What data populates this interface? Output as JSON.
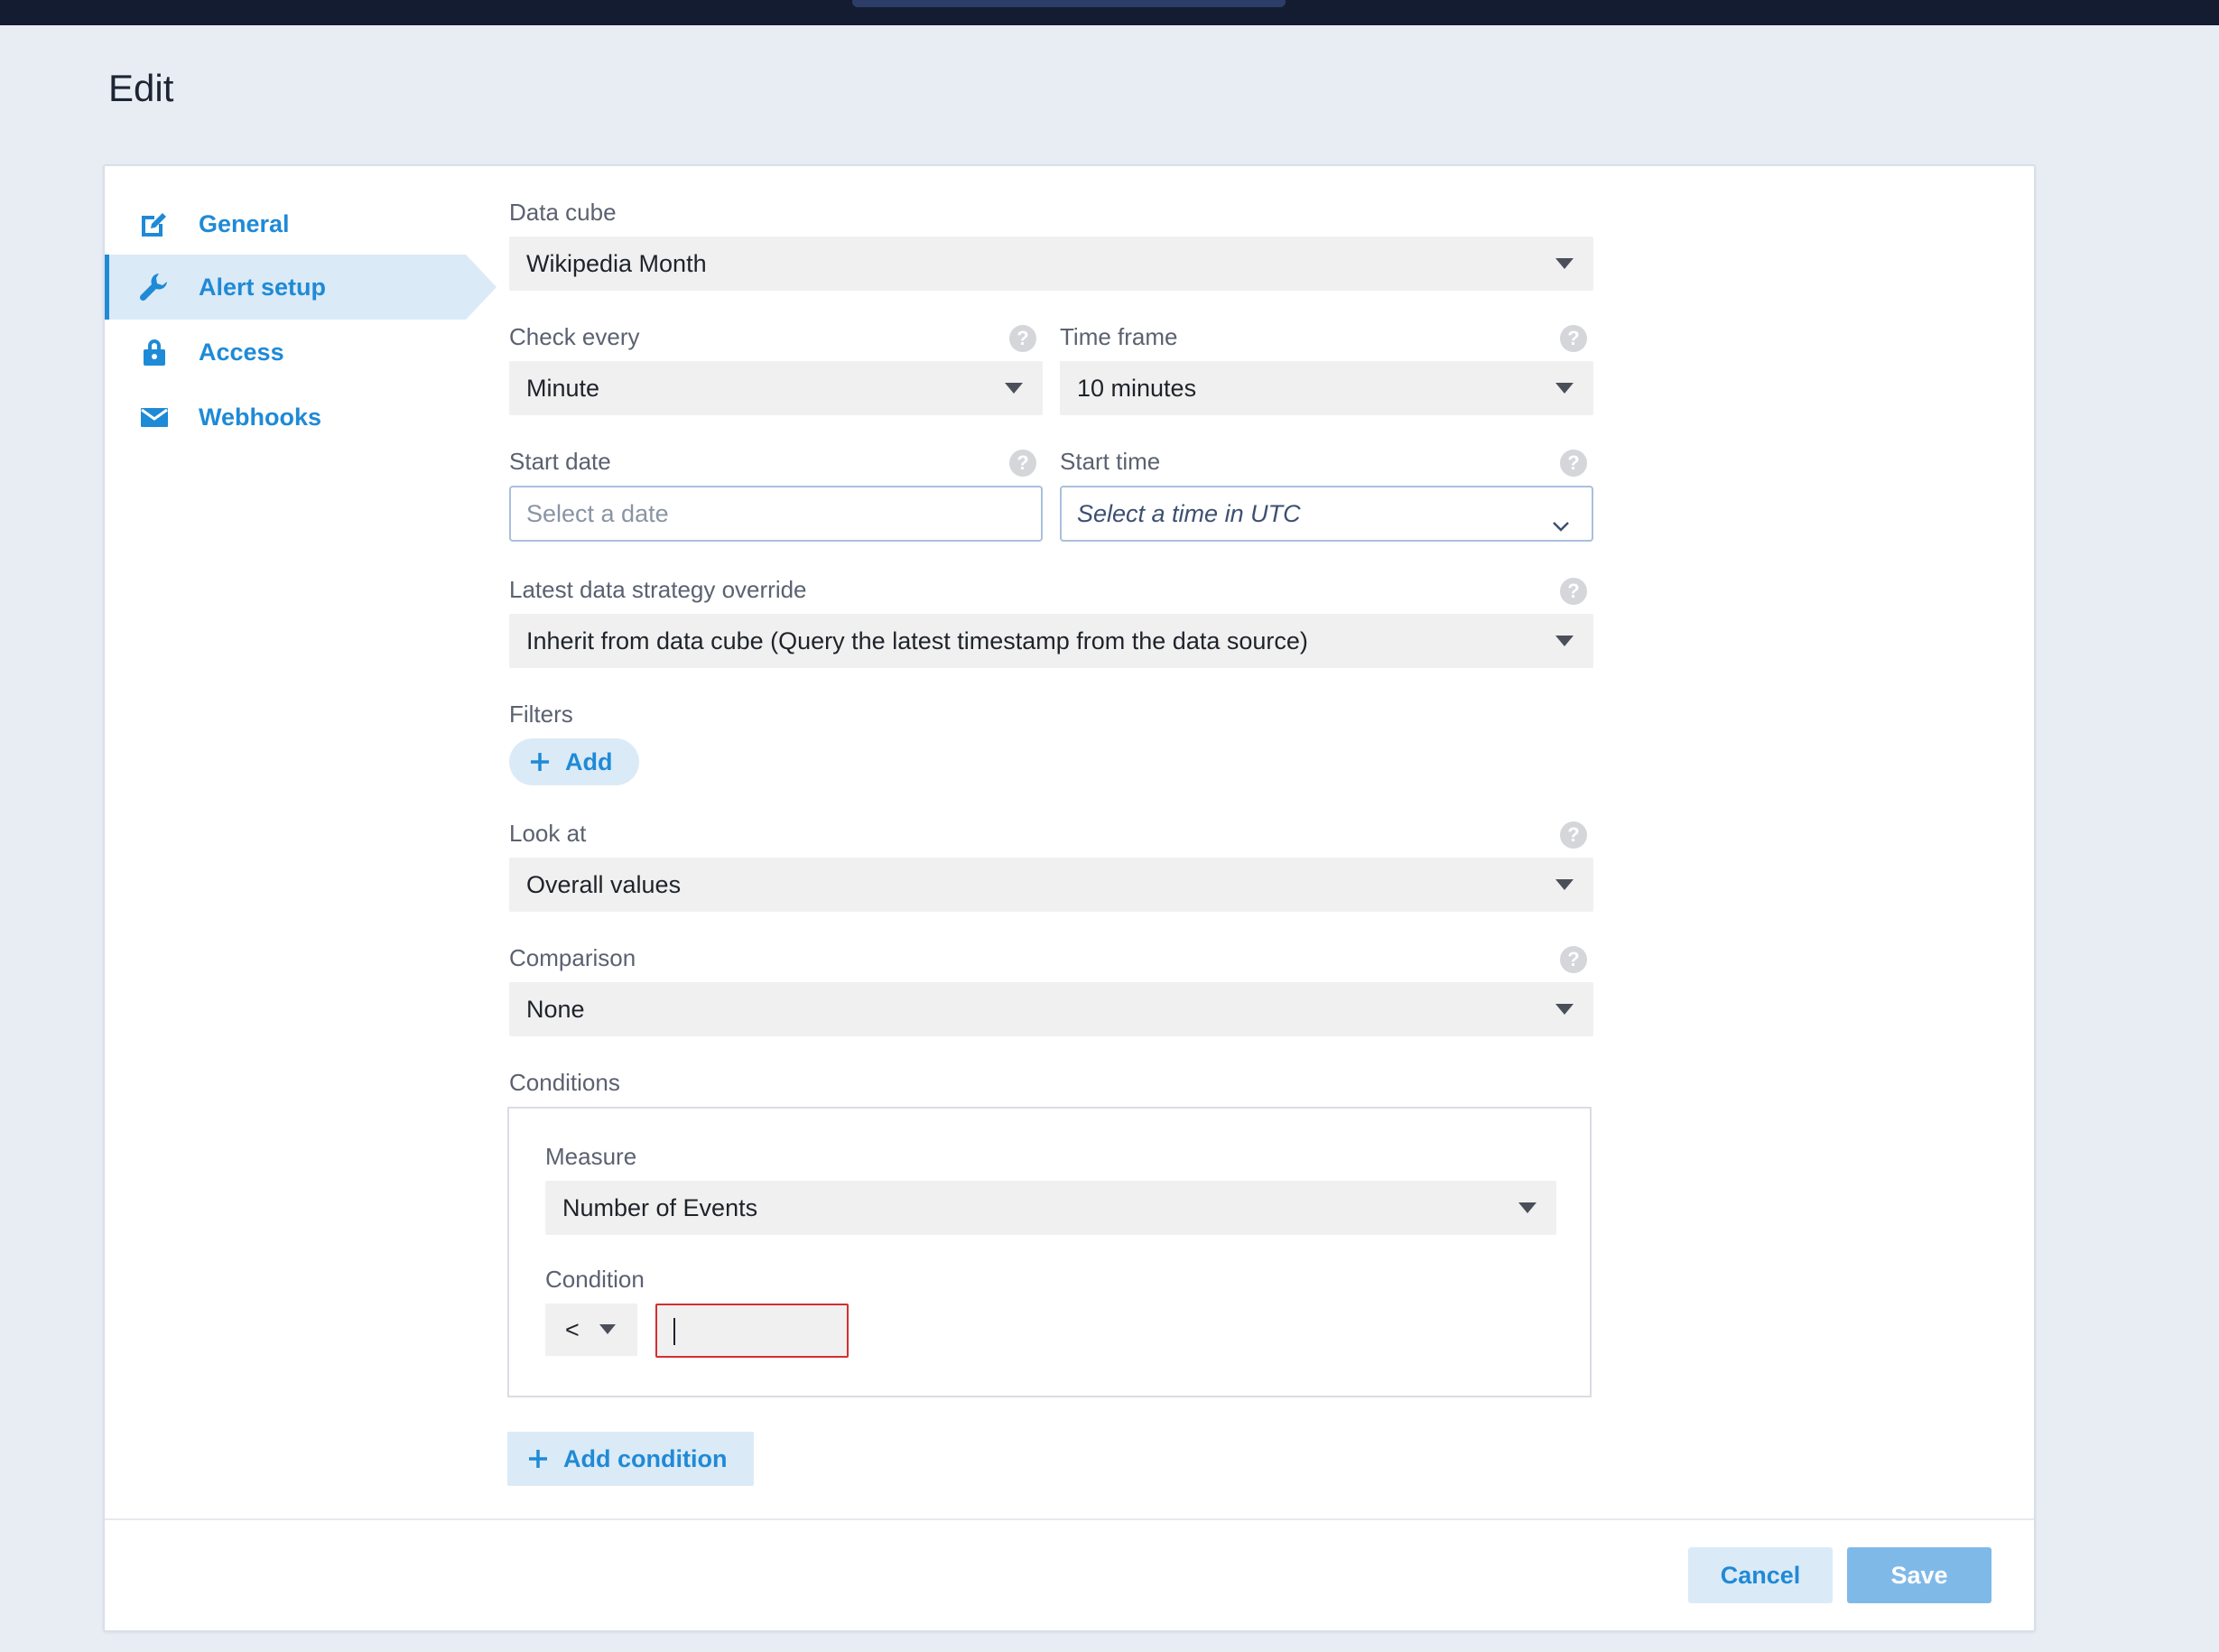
{
  "page": {
    "title": "Edit"
  },
  "sidebar": {
    "items": [
      {
        "label": "General",
        "icon": "edit-icon",
        "active": false
      },
      {
        "label": "Alert setup",
        "icon": "wrench-icon",
        "active": true
      },
      {
        "label": "Access",
        "icon": "lock-icon",
        "active": false
      },
      {
        "label": "Webhooks",
        "icon": "mail-icon",
        "active": false
      }
    ]
  },
  "form": {
    "data_cube": {
      "label": "Data cube",
      "value": "Wikipedia Month"
    },
    "check_every": {
      "label": "Check every",
      "value": "Minute",
      "help": "?"
    },
    "time_frame": {
      "label": "Time frame",
      "value": "10 minutes",
      "help": "?"
    },
    "start_date": {
      "label": "Start date",
      "placeholder": "Select a date",
      "help": "?"
    },
    "start_time": {
      "label": "Start time",
      "placeholder": "Select a time in UTC",
      "help": "?"
    },
    "latest_data_strategy": {
      "label": "Latest data strategy override",
      "value": "Inherit from data cube (Query the latest timestamp from the data source)",
      "help": "?"
    },
    "filters": {
      "label": "Filters",
      "add_label": "Add"
    },
    "look_at": {
      "label": "Look at",
      "value": "Overall values",
      "help": "?"
    },
    "comparison": {
      "label": "Comparison",
      "value": "None",
      "help": "?"
    },
    "conditions": {
      "label": "Conditions",
      "measure_label": "Measure",
      "measure_value": "Number of Events",
      "condition_label": "Condition",
      "operator": "<",
      "value": ""
    },
    "add_condition_label": "Add condition"
  },
  "footer": {
    "cancel_label": "Cancel",
    "save_label": "Save"
  },
  "colors": {
    "accent": "#1f8ad6",
    "accent_light": "#dbeaf7",
    "save_disabled": "#7fb9e8",
    "error_border": "#d32f2f",
    "topbar": "#141c31"
  }
}
